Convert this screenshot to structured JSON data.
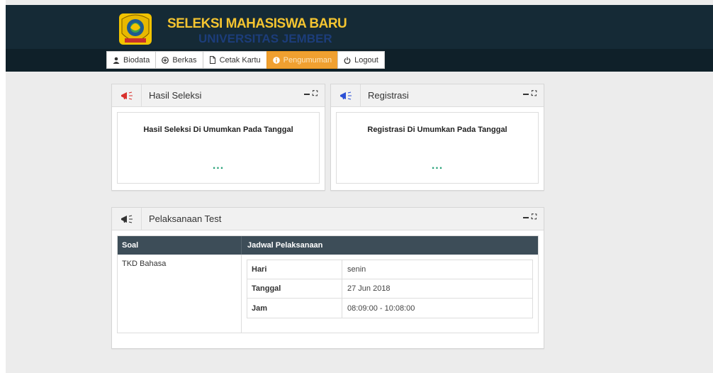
{
  "brand": {
    "title": "SELEKSI MAHASISWA BARU",
    "subtitle": "UNIVERSITAS JEMBER"
  },
  "nav": {
    "items": [
      {
        "label": "Biodata",
        "icon": "user-icon"
      },
      {
        "label": "Berkas",
        "icon": "circle-plus-icon"
      },
      {
        "label": "Cetak Kartu",
        "icon": "file-icon"
      },
      {
        "label": "Pengumuman",
        "icon": "info-icon",
        "active": true
      },
      {
        "label": "Logout",
        "icon": "power-icon"
      }
    ]
  },
  "panels": {
    "hasil": {
      "title": "Hasil Seleksi",
      "message": "Hasil Seleksi Di Umumkan Pada Tanggal",
      "value": "..."
    },
    "registrasi": {
      "title": "Registrasi",
      "message": "Registrasi Di Umumkan Pada Tanggal",
      "value": "..."
    },
    "test": {
      "title": "Pelaksanaan Test",
      "col_soal": "Soal",
      "col_jadwal": "Jadwal Pelaksanaan",
      "soal": "TKD Bahasa",
      "schedule": [
        {
          "key": "Hari",
          "value": "senin"
        },
        {
          "key": "Tanggal",
          "value": "27 Jun 2018"
        },
        {
          "key": "Jam",
          "value": "08:09:00 - 10:08:00"
        }
      ]
    }
  },
  "colors": {
    "header_bg": "#152a36",
    "accent_orange": "#f0a030",
    "brand_yellow": "#f4c430",
    "icon_red": "#d9302c",
    "icon_blue": "#2a4fd6",
    "dots_green": "#2aa37a"
  }
}
